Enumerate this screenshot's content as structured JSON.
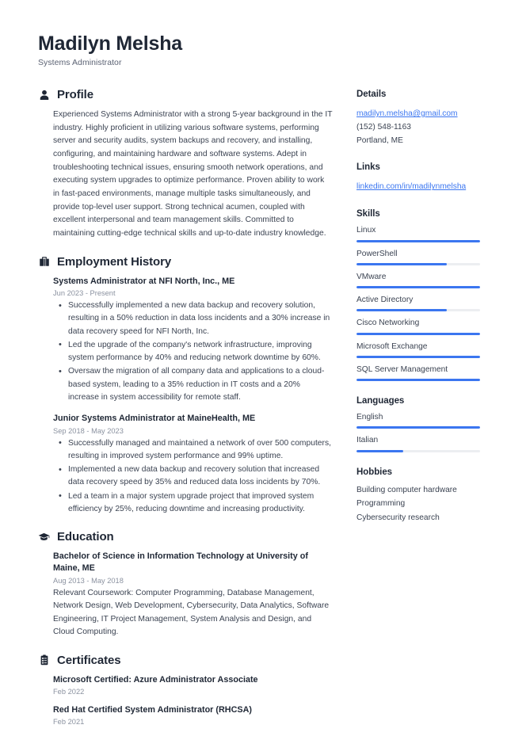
{
  "accent_color": "#3b76f0",
  "header": {
    "name": "Madilyn Melsha",
    "title": "Systems Administrator"
  },
  "sections": {
    "profile": {
      "icon": "user-icon",
      "title": "Profile",
      "text": "Experienced Systems Administrator with a strong 5-year background in the IT industry. Highly proficient in utilizing various software systems, performing server and security audits, system backups and recovery, and installing, configuring, and maintaining hardware and software systems. Adept in troubleshooting technical issues, ensuring smooth network operations, and executing system upgrades to optimize performance. Proven ability to work in fast-paced environments, manage multiple tasks simultaneously, and provide top-level user support. Strong technical acumen, coupled with excellent interpersonal and team management skills. Committed to maintaining cutting-edge technical skills and up-to-date industry knowledge."
    },
    "employment": {
      "icon": "briefcase-icon",
      "title": "Employment History",
      "entries": [
        {
          "title": "Systems Administrator at NFI North, Inc., ME",
          "date": "Jun 2023 - Present",
          "bullets": [
            "Successfully implemented a new data backup and recovery solution, resulting in a 50% reduction in data loss incidents and a 30% increase in data recovery speed for NFI North, Inc.",
            "Led the upgrade of the company's network infrastructure, improving system performance by 40% and reducing network downtime by 60%.",
            "Oversaw the migration of all company data and applications to a cloud-based system, leading to a 35% reduction in IT costs and a 20% increase in system accessibility for remote staff."
          ]
        },
        {
          "title": "Junior Systems Administrator at MaineHealth, ME",
          "date": "Sep 2018 - May 2023",
          "bullets": [
            "Successfully managed and maintained a network of over 500 computers, resulting in improved system performance and 99% uptime.",
            "Implemented a new data backup and recovery solution that increased data recovery speed by 35% and reduced data loss incidents by 70%.",
            "Led a team in a major system upgrade project that improved system efficiency by 25%, reducing downtime and increasing productivity."
          ]
        }
      ]
    },
    "education": {
      "icon": "graduation-cap-icon",
      "title": "Education",
      "entries": [
        {
          "title": "Bachelor of Science in Information Technology at University of Maine, ME",
          "date": "Aug 2013 - May 2018",
          "description": "Relevant Coursework: Computer Programming, Database Management, Network Design, Web Development, Cybersecurity, Data Analytics, Software Engineering, IT Project Management, System Analysis and Design, and Cloud Computing."
        }
      ]
    },
    "certificates": {
      "icon": "clipboard-icon",
      "title": "Certificates",
      "entries": [
        {
          "title": "Microsoft Certified: Azure Administrator Associate",
          "date": "Feb 2022"
        },
        {
          "title": "Red Hat Certified System Administrator (RHCSA)",
          "date": "Feb 2021"
        }
      ]
    }
  },
  "sidebar": {
    "details": {
      "title": "Details",
      "email": "madilyn.melsha@gmail.com",
      "phone": "(152) 548-1163",
      "location": "Portland, ME"
    },
    "links": {
      "title": "Links",
      "items": [
        {
          "label": "linkedin.com/in/madilynmelsha"
        }
      ]
    },
    "skills": {
      "title": "Skills",
      "items": [
        {
          "label": "Linux",
          "level": 100
        },
        {
          "label": "PowerShell",
          "level": 73
        },
        {
          "label": "VMware",
          "level": 100
        },
        {
          "label": "Active Directory",
          "level": 73
        },
        {
          "label": "Cisco Networking",
          "level": 100
        },
        {
          "label": "Microsoft Exchange",
          "level": 100
        },
        {
          "label": "SQL Server Management",
          "level": 100
        }
      ]
    },
    "languages": {
      "title": "Languages",
      "items": [
        {
          "label": "English",
          "level": 100
        },
        {
          "label": "Italian",
          "level": 38
        }
      ]
    },
    "hobbies": {
      "title": "Hobbies",
      "items": [
        {
          "label": "Building computer hardware"
        },
        {
          "label": "Programming"
        },
        {
          "label": "Cybersecurity research"
        }
      ]
    }
  }
}
